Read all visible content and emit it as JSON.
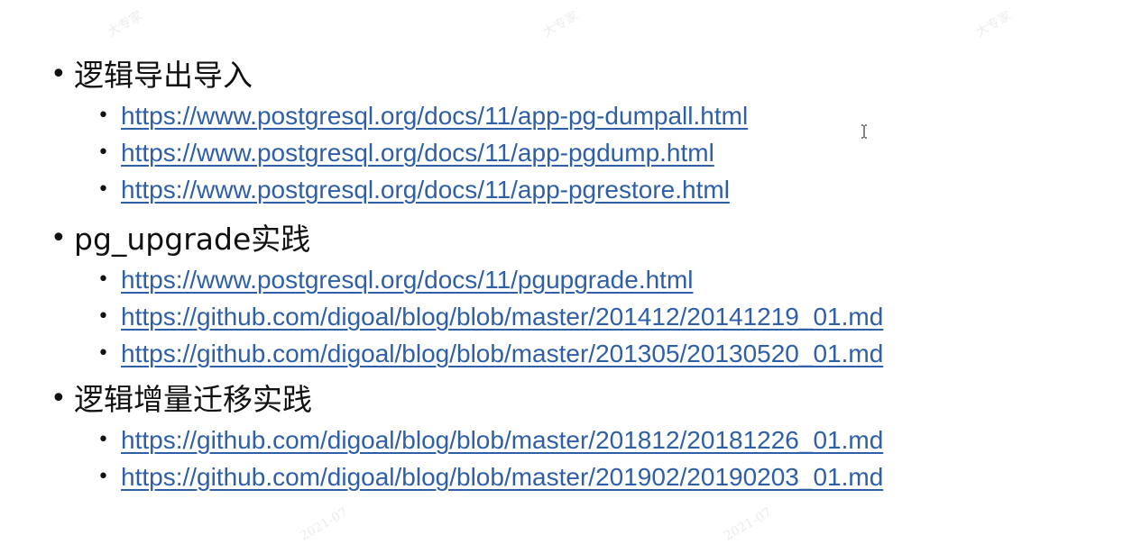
{
  "sections": [
    {
      "title": "逻辑导出导入",
      "links": [
        "https://www.postgresql.org/docs/11/app-pg-dumpall.html",
        "https://www.postgresql.org/docs/11/app-pgdump.html",
        "https://www.postgresql.org/docs/11/app-pgrestore.html"
      ]
    },
    {
      "title": "pg_upgrade实践",
      "links": [
        "https://www.postgresql.org/docs/11/pgupgrade.html",
        "https://github.com/digoal/blog/blob/master/201412/20141219_01.md",
        "https://github.com/digoal/blog/blob/master/201305/20130520_01.md"
      ]
    },
    {
      "title": "逻辑增量迁移实践",
      "links": [
        "https://github.com/digoal/blog/blob/master/201812/20181226_01.md",
        "https://github.com/digoal/blog/blob/master/201902/20190203_01.md"
      ]
    }
  ],
  "bullet": "•",
  "colors": {
    "link": "#2f5fa7",
    "text": "#111111",
    "background": "#ffffff"
  },
  "icons": [
    "text-cursor-icon"
  ]
}
